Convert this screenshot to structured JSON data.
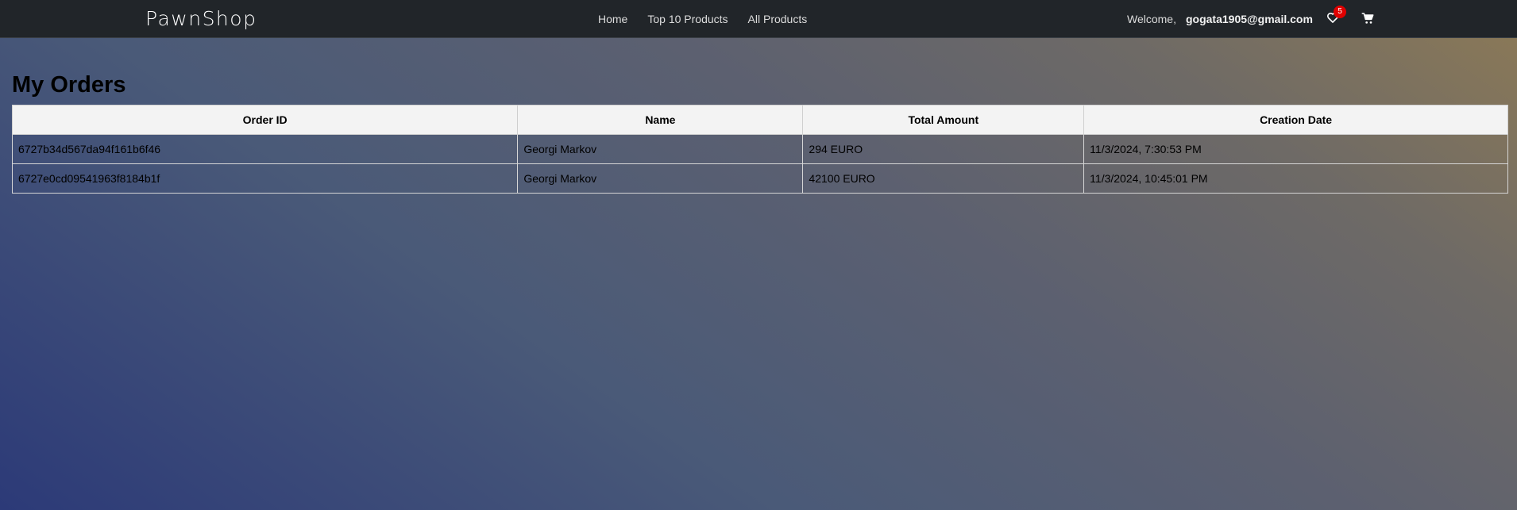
{
  "brand": "PawnShop",
  "nav": {
    "links": [
      "Home",
      "Top 10 Products",
      "All Products"
    ]
  },
  "user": {
    "welcome": "Welcome,",
    "email": "gogata1905@gmail.com"
  },
  "wishlist": {
    "icon": "heart-icon",
    "count": "5"
  },
  "cart": {
    "icon": "cart-icon"
  },
  "page": {
    "title": "My Orders"
  },
  "orders": {
    "headers": [
      "Order ID",
      "Name",
      "Total Amount",
      "Creation Date"
    ],
    "rows": [
      [
        "6727b34d567da94f161b6f46",
        "Georgi Markov",
        "294 EURO",
        "11/3/2024, 7:30:53 PM"
      ],
      [
        "6727e0cd09541963f8184b1f",
        "Georgi Markov",
        "42100 EURO",
        "11/3/2024, 10:45:01 PM"
      ]
    ]
  },
  "colors": {
    "navbar": "#212529",
    "badge": "#e00000"
  }
}
